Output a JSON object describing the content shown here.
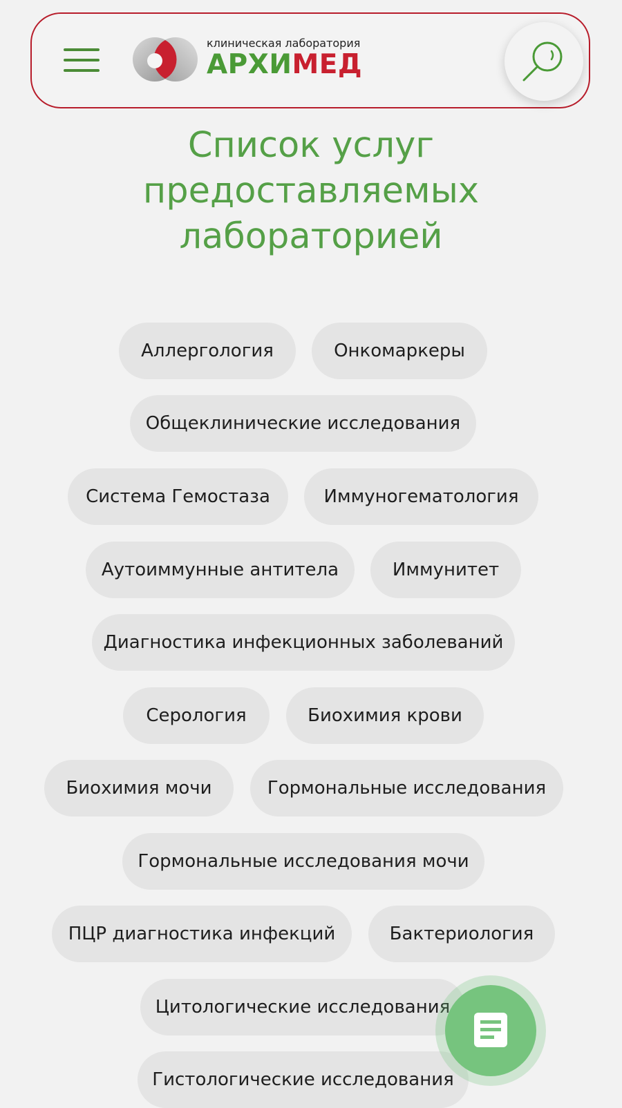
{
  "header": {
    "logo_subtitle": "клиническая лаборатория",
    "logo_name_part1": "АРХИ",
    "logo_name_part2": "МЕД"
  },
  "main": {
    "title": "Список услуг предоставляемых лабораторией",
    "categories": [
      "Аллергология",
      "Онкомаркеры",
      "Общеклинические исследования",
      "Система Гемостаза",
      "Иммуногематология",
      "Аутоиммунные антитела",
      "Иммунитет",
      "Диагностика инфекционных заболеваний",
      "Серология",
      "Биохимия крови",
      "Биохимия мочи",
      "Гормональные исследования",
      "Гормональные исследования мочи",
      "ПЦР диагностика инфекций",
      "Бактериология",
      "Цитологические исследования",
      "Гистологические исследования"
    ]
  },
  "icons": {
    "menu": "hamburger-menu-icon",
    "search": "search-icon",
    "fab": "document-icon"
  },
  "colors": {
    "brand_green": "#4a9a36",
    "brand_red": "#c8202f",
    "title_green": "#55a047",
    "chip_bg": "#e4e4e4",
    "fab_green": "#76c47e",
    "header_border": "#b71c2a",
    "page_bg": "#f2f2f2"
  }
}
